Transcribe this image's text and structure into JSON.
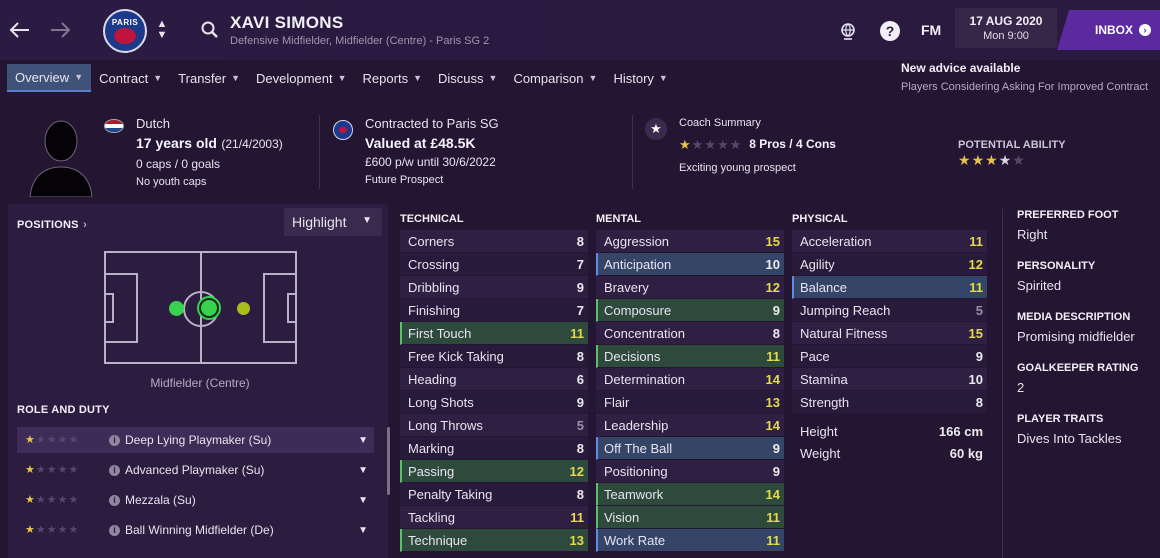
{
  "header": {
    "player_name": "XAVI SIMONS",
    "player_sub": "Defensive Midfielder, Midfielder (Centre) - Paris SG 2",
    "club_badge_text": "PARIS",
    "date": "17 AUG 2020",
    "day_time": "Mon 9:00",
    "fm_logo": "FM",
    "inbox_label": "INBOX",
    "icons": [
      "back-arrow-icon",
      "forward-arrow-icon",
      "badge-switch-icon",
      "search-icon",
      "world-icon",
      "help-icon"
    ]
  },
  "tabs": [
    {
      "label": "Overview",
      "active": true
    },
    {
      "label": "Contract"
    },
    {
      "label": "Transfer"
    },
    {
      "label": "Development"
    },
    {
      "label": "Reports"
    },
    {
      "label": "Discuss"
    },
    {
      "label": "Comparison"
    },
    {
      "label": "History"
    }
  ],
  "advice": {
    "title": "New advice available",
    "text": "Players Considering Asking For Improved Contract"
  },
  "summary": {
    "nationality": "Dutch",
    "age": "17 years old",
    "dob": "(21/4/2003)",
    "caps_goals": "0 caps / 0 goals",
    "youth_caps": "No youth caps",
    "contract_line": "Contracted to Paris SG",
    "value": "Valued at £48.5K",
    "wage": "£600 p/w until 30/6/2022",
    "prospect": "Future Prospect",
    "coach_title": "Coach Summary",
    "pros_cons": "8 Pros / 4 Cons",
    "coach_note": "Exciting young prospect",
    "coach_stars": 1,
    "potential_title": "POTENTIAL ABILITY",
    "potential_stars": 3.5
  },
  "positions": {
    "title": "POSITIONS",
    "highlight_label": "Highlight",
    "position_label": "Midfielder (Centre)",
    "role_title": "ROLE AND DUTY",
    "roles": [
      {
        "name": "Deep Lying Playmaker (Su)",
        "stars": 1
      },
      {
        "name": "Advanced Playmaker (Su)",
        "stars": 1
      },
      {
        "name": "Mezzala (Su)",
        "stars": 1
      },
      {
        "name": "Ball Winning Midfielder (De)",
        "stars": 1
      }
    ]
  },
  "technical": {
    "title": "TECHNICAL",
    "rows": [
      {
        "name": "Corners",
        "value": "8"
      },
      {
        "name": "Crossing",
        "value": "7"
      },
      {
        "name": "Dribbling",
        "value": "9"
      },
      {
        "name": "Finishing",
        "value": "7"
      },
      {
        "name": "First Touch",
        "value": "11"
      },
      {
        "name": "Free Kick Taking",
        "value": "8"
      },
      {
        "name": "Heading",
        "value": "6"
      },
      {
        "name": "Long Shots",
        "value": "9"
      },
      {
        "name": "Long Throws",
        "value": "5"
      },
      {
        "name": "Marking",
        "value": "8"
      },
      {
        "name": "Passing",
        "value": "12"
      },
      {
        "name": "Penalty Taking",
        "value": "8"
      },
      {
        "name": "Tackling",
        "value": "11"
      },
      {
        "name": "Technique",
        "value": "13"
      }
    ]
  },
  "mental": {
    "title": "MENTAL",
    "rows": [
      {
        "name": "Aggression",
        "value": "15"
      },
      {
        "name": "Anticipation",
        "value": "10"
      },
      {
        "name": "Bravery",
        "value": "12"
      },
      {
        "name": "Composure",
        "value": "9"
      },
      {
        "name": "Concentration",
        "value": "8"
      },
      {
        "name": "Decisions",
        "value": "11"
      },
      {
        "name": "Determination",
        "value": "14"
      },
      {
        "name": "Flair",
        "value": "13"
      },
      {
        "name": "Leadership",
        "value": "14"
      },
      {
        "name": "Off The Ball",
        "value": "9"
      },
      {
        "name": "Positioning",
        "value": "9"
      },
      {
        "name": "Teamwork",
        "value": "14"
      },
      {
        "name": "Vision",
        "value": "11"
      },
      {
        "name": "Work Rate",
        "value": "11"
      }
    ]
  },
  "physical": {
    "title": "PHYSICAL",
    "rows": [
      {
        "name": "Acceleration",
        "value": "11"
      },
      {
        "name": "Agility",
        "value": "12"
      },
      {
        "name": "Balance",
        "value": "11"
      },
      {
        "name": "Jumping Reach",
        "value": "5"
      },
      {
        "name": "Natural Fitness",
        "value": "15"
      },
      {
        "name": "Pace",
        "value": "9"
      },
      {
        "name": "Stamina",
        "value": "10"
      },
      {
        "name": "Strength",
        "value": "8"
      }
    ],
    "height_label": "Height",
    "height": "166 cm",
    "weight_label": "Weight",
    "weight": "60 kg"
  },
  "info": {
    "preferred_foot_title": "PREFERRED FOOT",
    "preferred_foot": "Right",
    "personality_title": "PERSONALITY",
    "personality": "Spirited",
    "media_title": "MEDIA DESCRIPTION",
    "media": "Promising midfielder",
    "gk_title": "GOALKEEPER RATING",
    "gk": "2",
    "traits_title": "PLAYER TRAITS",
    "traits": "Dives Into Tackles"
  },
  "colors": {
    "background": "#241533",
    "accent_purple": "#5b2a9e",
    "highlight_yellow": "#e5da4b",
    "highlight_green": "#59c06a",
    "highlight_blue": "#5b8de0",
    "star_gold": "#e7c34a"
  }
}
